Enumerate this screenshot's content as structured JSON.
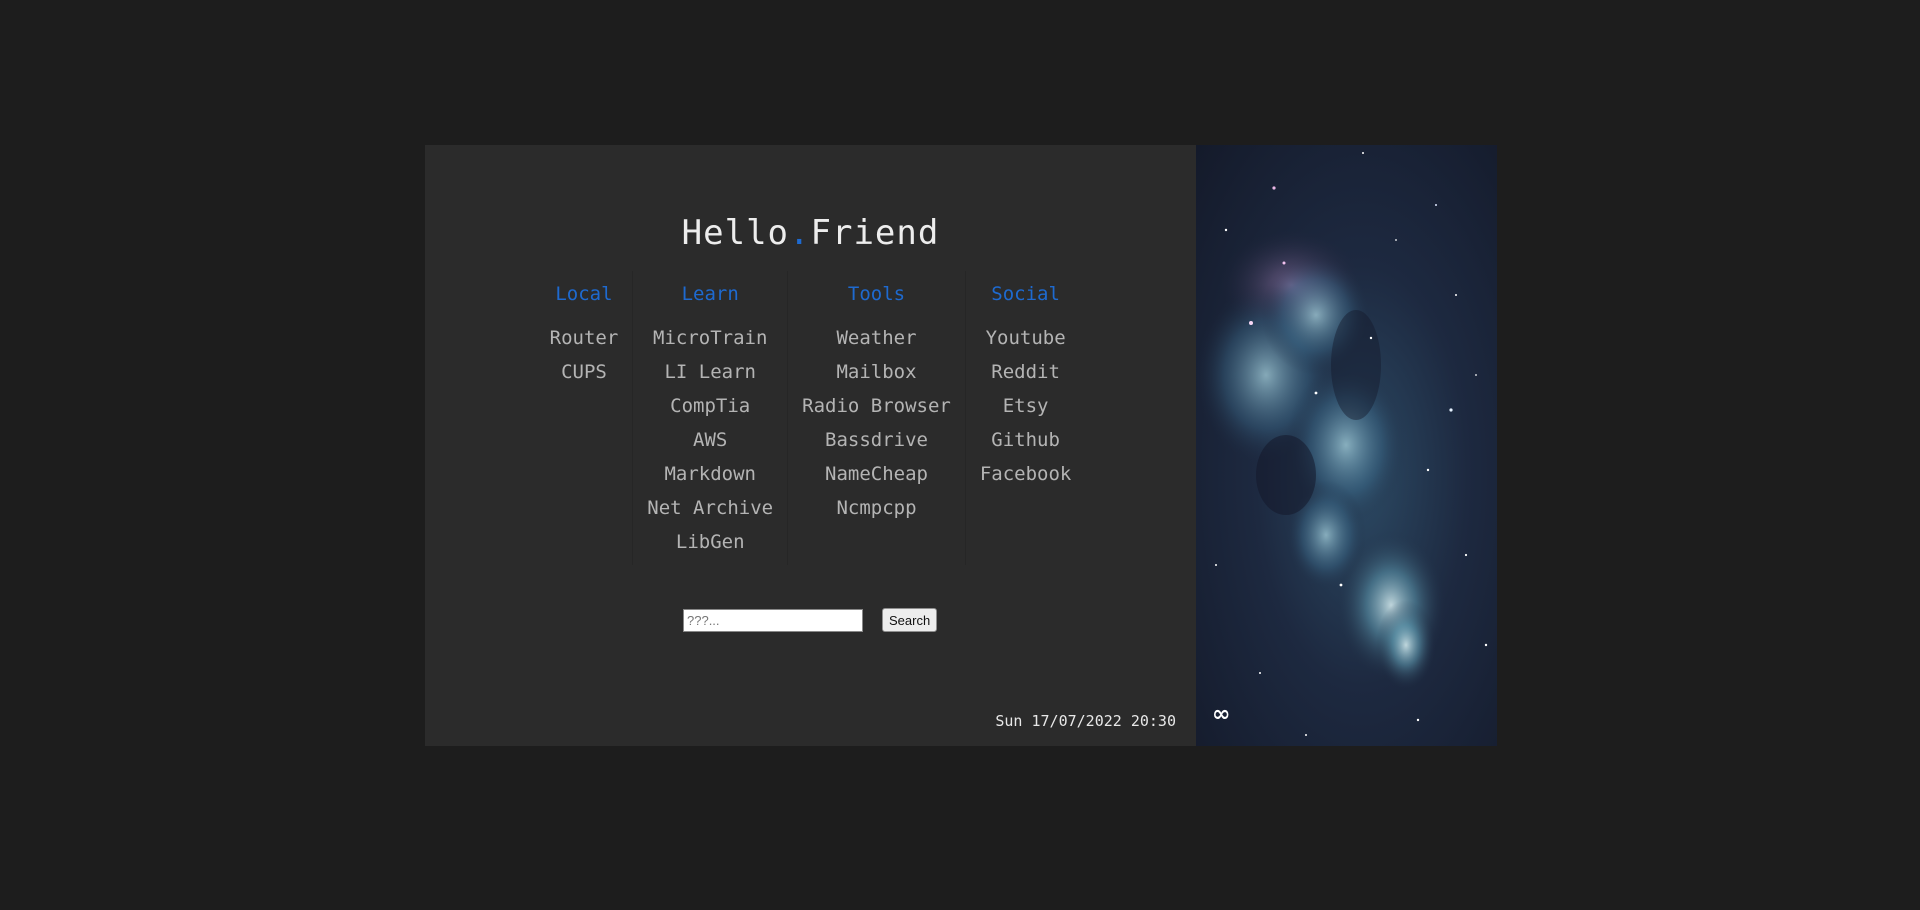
{
  "title": {
    "part1": "Hello",
    "dot": ".",
    "part2": "Friend"
  },
  "columns": [
    {
      "heading": "Local",
      "links": [
        "Router",
        "CUPS"
      ]
    },
    {
      "heading": "Learn",
      "links": [
        "MicroTrain",
        "LI Learn",
        "CompTia",
        "AWS",
        "Markdown",
        "Net Archive",
        "LibGen"
      ]
    },
    {
      "heading": "Tools",
      "links": [
        "Weather",
        "Mailbox",
        "Radio Browser",
        "Bassdrive",
        "NameCheap",
        "Ncmpcpp"
      ]
    },
    {
      "heading": "Social",
      "links": [
        "Youtube",
        "Reddit",
        "Etsy",
        "Github",
        "Facebook"
      ]
    }
  ],
  "search": {
    "placeholder": "???...",
    "button_label": "Search"
  },
  "datetime": "Sun 17/07/2022 20:30",
  "side": {
    "symbol": "∞"
  },
  "colors": {
    "accent": "#1e6ad0",
    "panel": "#2b2b2b",
    "background": "#1d1d1d",
    "link": "#b4b4b4"
  }
}
